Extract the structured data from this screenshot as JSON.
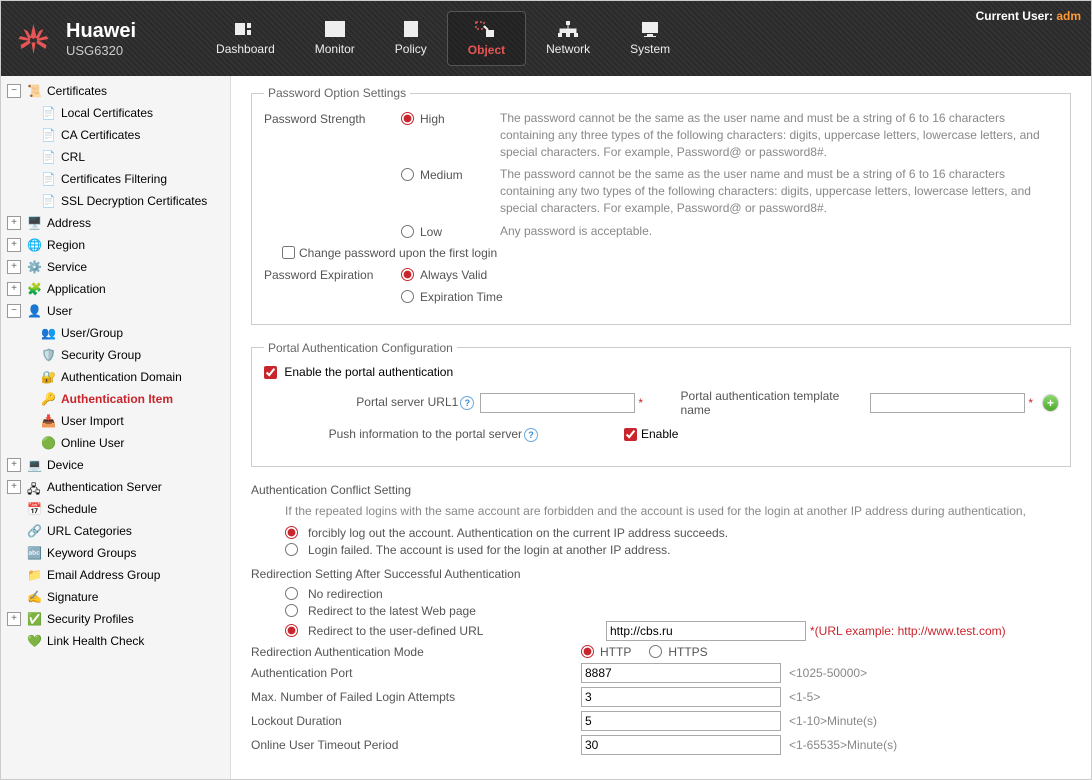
{
  "header": {
    "brand": "Huawei",
    "model": "USG6320",
    "current_user_label": "Current User:",
    "current_user_name": "adm",
    "tabs": [
      {
        "id": "dashboard",
        "label": "Dashboard"
      },
      {
        "id": "monitor",
        "label": "Monitor"
      },
      {
        "id": "policy",
        "label": "Policy"
      },
      {
        "id": "object",
        "label": "Object"
      },
      {
        "id": "network",
        "label": "Network"
      },
      {
        "id": "system",
        "label": "System"
      }
    ]
  },
  "sidebar": {
    "certificates": {
      "label": "Certificates"
    },
    "local_cert": {
      "label": "Local Certificates"
    },
    "ca_cert": {
      "label": "CA Certificates"
    },
    "crl": {
      "label": "CRL"
    },
    "cert_filtering": {
      "label": "Certificates Filtering"
    },
    "ssl_decrypt": {
      "label": "SSL Decryption Certificates"
    },
    "address": {
      "label": "Address"
    },
    "region": {
      "label": "Region"
    },
    "service": {
      "label": "Service"
    },
    "application": {
      "label": "Application"
    },
    "user": {
      "label": "User"
    },
    "user_group": {
      "label": "User/Group"
    },
    "security_group": {
      "label": "Security Group"
    },
    "auth_domain": {
      "label": "Authentication Domain"
    },
    "auth_item": {
      "label": "Authentication Item"
    },
    "user_import": {
      "label": "User Import"
    },
    "online_user": {
      "label": "Online User"
    },
    "device": {
      "label": "Device"
    },
    "auth_server": {
      "label": "Authentication Server"
    },
    "schedule": {
      "label": "Schedule"
    },
    "url_categories": {
      "label": "URL Categories"
    },
    "keyword_groups": {
      "label": "Keyword Groups"
    },
    "email_group": {
      "label": "Email Address Group"
    },
    "signature": {
      "label": "Signature"
    },
    "sec_profiles": {
      "label": "Security Profiles"
    },
    "link_health": {
      "label": "Link Health Check"
    }
  },
  "pw_settings": {
    "legend": "Password Option Settings",
    "strength_label": "Password Strength",
    "high": {
      "label": "High",
      "desc": "The password cannot be the same as the user name and must be a string of 6 to 16 characters containing any three types of the following characters: digits, uppercase letters, lowercase letters, and special characters. For example, Password@ or password8#."
    },
    "medium": {
      "label": "Medium",
      "desc": "The password cannot be the same as the user name and must be a string of 6 to 16 characters containing any two types of the following characters: digits, uppercase letters, lowercase letters, and special characters. For example, Password@ or password8#."
    },
    "low": {
      "label": "Low",
      "desc": "Any password is acceptable."
    },
    "change_first_login": "Change password upon the first login",
    "expiration_label": "Password Expiration",
    "always_valid": "Always Valid",
    "expiration_time": "Expiration Time"
  },
  "portal": {
    "legend": "Portal Authentication Configuration",
    "enable_label": "Enable the portal authentication",
    "url_label": "Portal server URL1",
    "tpl_label": "Portal authentication template name",
    "push_label": "Push information to the portal server",
    "push_enable": "Enable"
  },
  "conflict": {
    "title": "Authentication Conflict Setting",
    "desc": "If the repeated logins with the same account are forbidden and the account is used for the login at another IP address during authentication,",
    "opt1": "forcibly log out the account. Authentication on the current IP address succeeds.",
    "opt2": "Login failed. The account is used for the login at another IP address."
  },
  "redirect": {
    "title": "Redirection Setting After Successful Authentication",
    "opt_none": "No redirection",
    "opt_latest": "Redirect to the latest Web page",
    "opt_user": "Redirect to the user-defined URL",
    "url_value": "http://cbs.ru",
    "url_hint": "*(URL example: http://www.test.com)"
  },
  "mode": {
    "label": "Redirection Authentication Mode",
    "http": "HTTP",
    "https": "HTTPS"
  },
  "fields": {
    "auth_port": {
      "label": "Authentication Port",
      "value": "8887",
      "hint": "<1025-50000>"
    },
    "max_failed": {
      "label": "Max. Number of Failed Login Attempts",
      "value": "3",
      "hint": "<1-5>"
    },
    "lockout": {
      "label": "Lockout Duration",
      "value": "5",
      "hint": "<1-10>Minute(s)"
    },
    "timeout": {
      "label": "Online User Timeout Period",
      "value": "30",
      "hint": "<1-65535>Minute(s)"
    }
  }
}
